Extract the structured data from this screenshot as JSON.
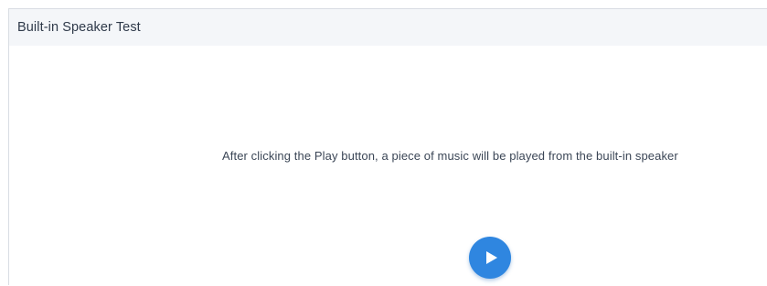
{
  "panel": {
    "title": "Built-in Speaker Test",
    "description": "After clicking the Play button, a piece of music will be played from the built-in speaker"
  },
  "play_button": {
    "icon": "play-icon",
    "color": "#2f86e0"
  }
}
